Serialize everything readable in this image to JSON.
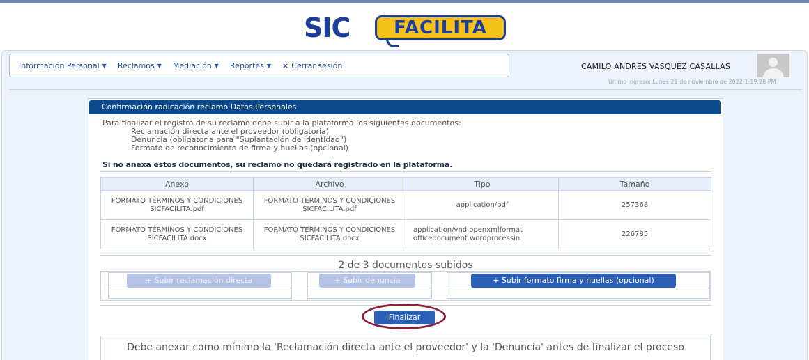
{
  "brand": {
    "logo_sic": "SIC",
    "logo_facilita": "FACILITA"
  },
  "nav": {
    "items": [
      {
        "label": "Información Personal"
      },
      {
        "label": "Reclamos"
      },
      {
        "label": "Mediación"
      },
      {
        "label": "Reportes"
      }
    ],
    "logout_label": "Cerrar sesión"
  },
  "user": {
    "name": "CAMILO ANDRES VASQUEZ CASALLAS",
    "last_login": "Ultimo ingreso: Lunes 21 de noviembre de 2022 1:19:28 PM"
  },
  "panel": {
    "title": "Confirmación radicación reclamo Datos Personales",
    "intro": "Para finalizar el registro de su reclamo debe subir a la plataforma los siguientes documentos:",
    "documents": [
      "Reclamación directa ante el proveedor (obligatoria)",
      "Denuncia (obligatoria para \"Suplantación de identidad\")",
      "Formato de reconocimiento de firma y huellas (opcional)"
    ],
    "warning": "Si no anexa estos documentos, su reclamo no quedará registrado en la plataforma."
  },
  "table": {
    "headers": [
      "Anexo",
      "Archivo",
      "Tipo",
      "Tamaño"
    ],
    "rows": [
      {
        "anexo": "FORMATO TÉRMINOS Y CONDICIONES SICFACILITA.pdf",
        "archivo": "FORMATO TÉRMINOS Y CONDICIONES SICFACILITA.pdf",
        "tipo": "application/pdf",
        "tamano": "257368"
      },
      {
        "anexo": "FORMATO TÉRMINOS Y CONDICIONES SICFACILITA.docx",
        "archivo": "FORMATO TÉRMINOS Y CONDICIONES SICFACILITA.docx",
        "tipo_line1": "application/vnd.openxmlformat",
        "tipo_line2": "officedocument.wordprocessin",
        "tamano": "226785"
      }
    ]
  },
  "uploads": {
    "status": "2 de 3 documentos subidos",
    "buttons": [
      {
        "label": "Subir reclamación directa",
        "state": "disabled"
      },
      {
        "label": "Subir denuncia",
        "state": "disabled"
      },
      {
        "label": "Subir formato firma y huellas (opcional)",
        "state": "enabled"
      }
    ]
  },
  "finalize": {
    "label": "Finalizar",
    "highlight_color": "#8c1f3a"
  },
  "note": "Debe anexar como mínimo la 'Reclamación directa ante el proveedor' y la 'Denuncia' antes de finalizar el proceso",
  "colors": {
    "header_blue": "#0d4a8d",
    "button_blue": "#2c5fb6",
    "brand_yellow": "#f6c11b"
  }
}
